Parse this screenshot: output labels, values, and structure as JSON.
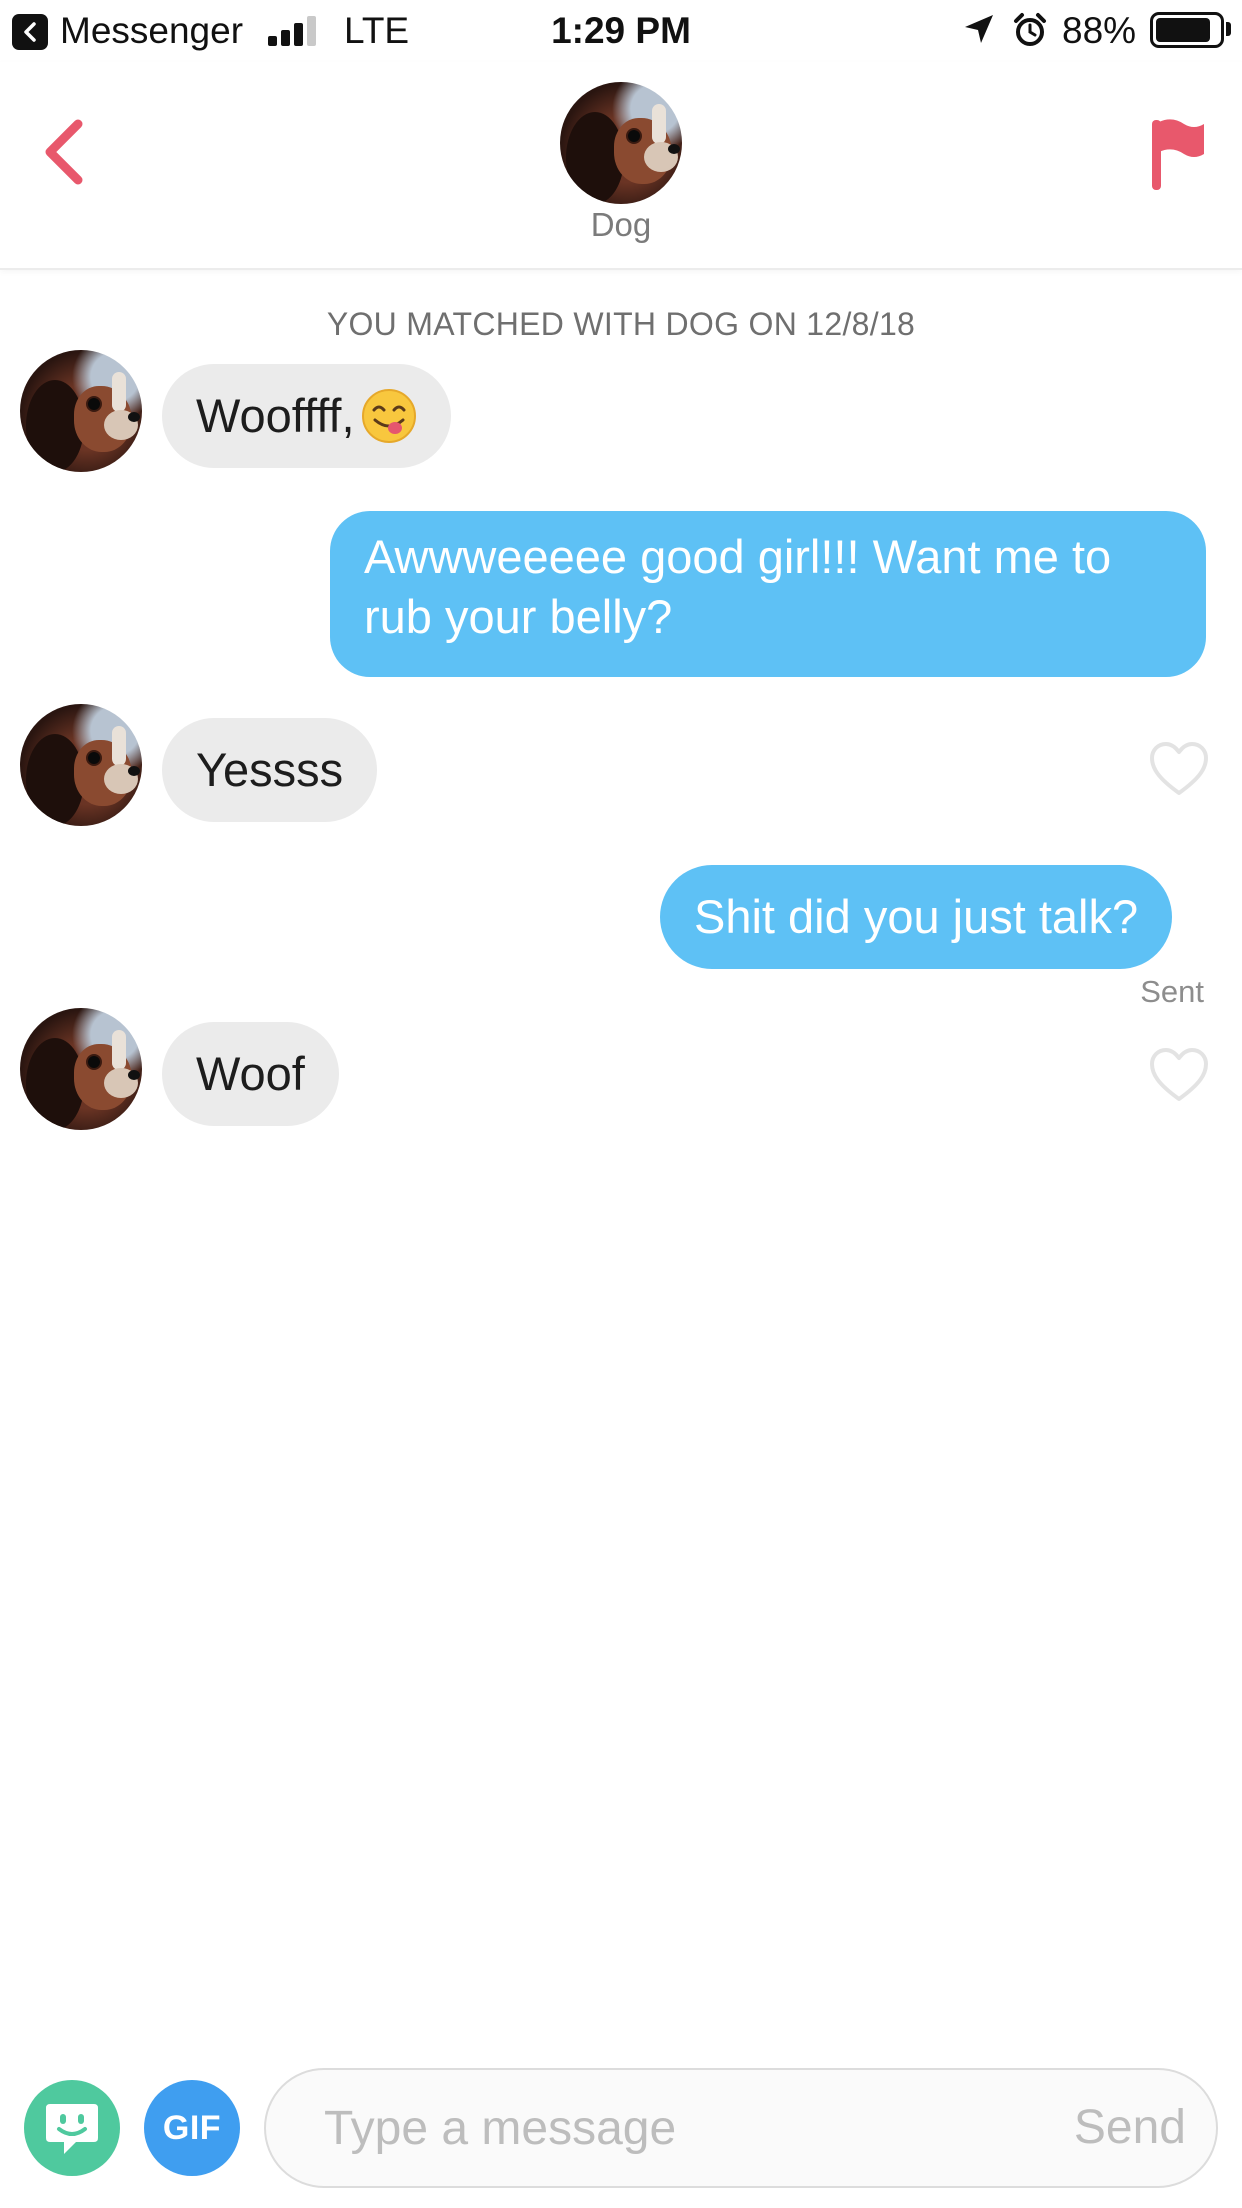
{
  "status_bar": {
    "back_app": "Messenger",
    "network": "LTE",
    "time": "1:29 PM",
    "battery_percent": "88%",
    "battery_level": 0.88,
    "signal_bars": 3,
    "icons": [
      "back-arrow-icon",
      "signal-icon",
      "location-icon",
      "alarm-icon",
      "battery-icon"
    ]
  },
  "header": {
    "name": "Dog",
    "back_icon": "chevron-left-icon",
    "report_icon": "flag-icon",
    "accent_color": "#E8586C"
  },
  "chat": {
    "match_text": "YOU MATCHED WITH DOG ON 12/8/18",
    "messages": [
      {
        "from": "Dog",
        "direction": "incoming",
        "text": "Wooffff,",
        "emoji": "face-savoring-food-emoji"
      },
      {
        "from": "me",
        "direction": "outgoing",
        "text_line1": "Awwweeeee good girl!!! Want me to",
        "text_line2": "rub your belly?"
      },
      {
        "from": "Dog",
        "direction": "incoming",
        "text": "Yessss",
        "like_icon": "heart-outline-icon"
      },
      {
        "from": "me",
        "direction": "outgoing",
        "text": "Shit did you just talk?"
      },
      {
        "from": "Dog",
        "direction": "incoming",
        "text": "Woof",
        "like_icon": "heart-outline-icon"
      }
    ],
    "sent_status": "Sent",
    "incoming_bubble_color": "#EBEBEB",
    "outgoing_bubble_color": "#5EC1F5"
  },
  "composer": {
    "sticker_icon": "sticker-face-icon",
    "gif_label": "GIF",
    "placeholder": "Type a message",
    "value": "",
    "send_label": "Send",
    "sticker_color": "#4FC99E",
    "gif_color": "#3F9EF0"
  }
}
